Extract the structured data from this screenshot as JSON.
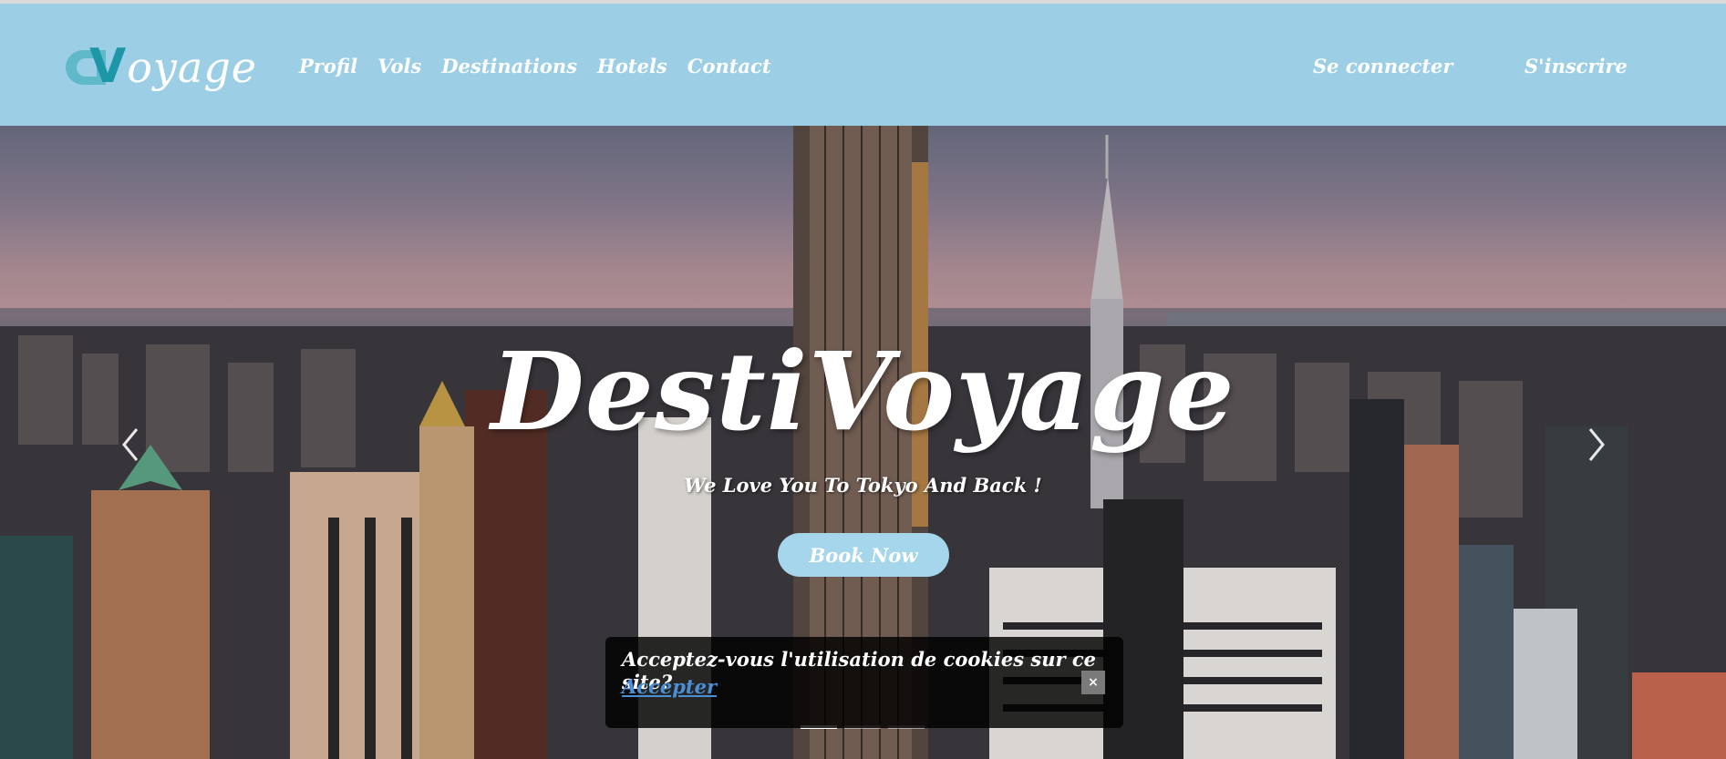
{
  "navbar": {
    "logo_text": "oyage",
    "logo_mark": "V",
    "links": [
      {
        "label": "Profil"
      },
      {
        "label": "Vols"
      },
      {
        "label": "Destinations"
      },
      {
        "label": "Hotels"
      },
      {
        "label": "Contact"
      }
    ],
    "login_label": "Se connecter",
    "signup_label": "S'inscrire"
  },
  "hero": {
    "title": "DestiVoyage",
    "subtitle": "We Love You To Tokyo And Back !",
    "cta_label": "Book Now",
    "prev_icon": "chevron-left-icon",
    "next_icon": "chevron-right-icon",
    "slides_count": 3,
    "active_slide": 1
  },
  "cookie": {
    "message": "Acceptez-vous l'utilisation de cookies sur ce site?",
    "accept_label": "Accepter",
    "close_label": "×"
  },
  "colors": {
    "navbar_bg": "#9ccfe6",
    "button_bg": "#a6d6ec",
    "accent": "#1d97a8",
    "link": "#4a8fd8"
  }
}
